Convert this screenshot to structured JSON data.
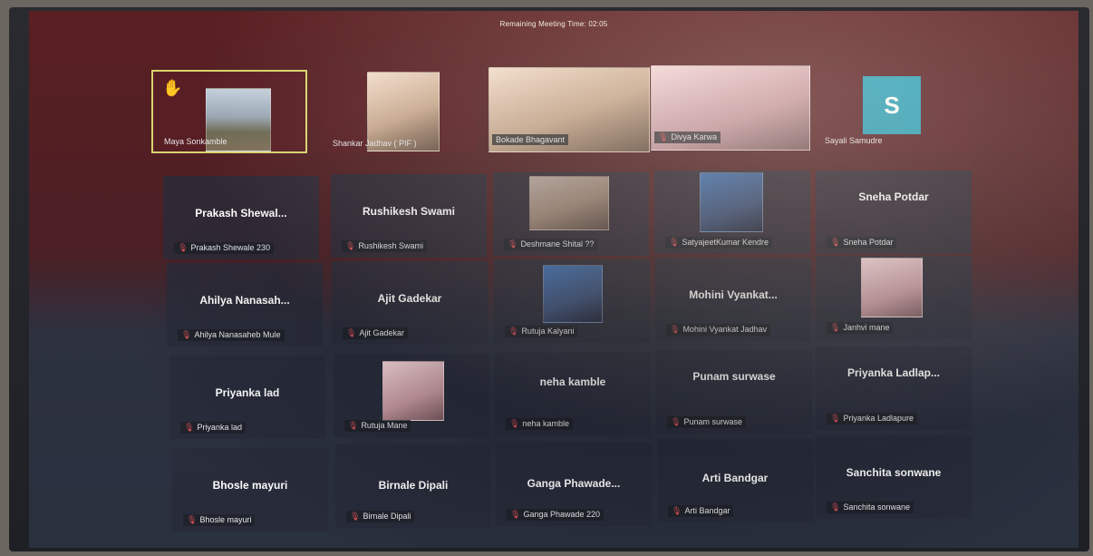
{
  "meeting": {
    "remaining_time": "Remaining Meeting Time: 02:05"
  },
  "tiles": {
    "maya": {
      "label": "Maya Sonkamble"
    },
    "shankar": {
      "label": "Shankar Jadhav ( PIF )"
    },
    "bokade": {
      "label": "Bokade Bhagavant"
    },
    "divya": {
      "label": "Divya Karwa"
    },
    "sayali": {
      "label": "Sayali Samudre",
      "initial": "S"
    },
    "prakash": {
      "display": "Prakash  Shewal...",
      "label": "Prakash Shewale 230"
    },
    "rushikesh": {
      "display": "Rushikesh Swami",
      "label": "Rushikesh Swami"
    },
    "deshmane": {
      "label": "Deshmane Shital  ??"
    },
    "satyajeet": {
      "label": "SatyajeetKumar Kendre"
    },
    "sneha": {
      "display": "Sneha Potdar",
      "label": "Sneha Potdar"
    },
    "ahilya": {
      "display": "Ahilya  Nanasah...",
      "label": "Ahilya Nanasaheb Mule"
    },
    "ajit": {
      "display": "Ajit Gadekar",
      "label": "Ajit Gadekar"
    },
    "rutujak": {
      "label": "Rutuja Kalyani"
    },
    "mohini": {
      "display": "Mohini  Vyankat...",
      "label": "Mohini Vyankat Jadhav"
    },
    "janhvi": {
      "label": "Janhvi mane"
    },
    "priyankalad": {
      "display": "Priyanka lad",
      "label": "Priyanka lad"
    },
    "rutujam": {
      "label": "Rutuja Mane"
    },
    "neha": {
      "display": "neha kamble",
      "label": "neha kamble"
    },
    "punam": {
      "display": "Punam surwase",
      "label": "Punam surwase"
    },
    "priyankaladla": {
      "display": "Priyanka  Ladlap...",
      "label": "Priyanka Ladlapure"
    },
    "bhosle": {
      "display": "Bhosle mayuri",
      "label": "Bhosle mayuri"
    },
    "birnale": {
      "display": "Birnale Dipali",
      "label": "Birnale Dipali"
    },
    "ganga": {
      "display": "Ganga  Phawade...",
      "label": "Ganga Phawade 220"
    },
    "arti": {
      "display": "Arti Bandgar",
      "label": "Arti Bandgar"
    },
    "sanchita": {
      "display": "Sanchita sonwane",
      "label": "Sanchita sonwane"
    }
  },
  "icons": {
    "muted_mic": "muted-mic-icon",
    "raised_hand": "raised-hand-icon"
  },
  "colors": {
    "active_border": "#d7d46d",
    "initial_avatar": "#2aa0b8",
    "muted_mic": "#e0525a"
  }
}
